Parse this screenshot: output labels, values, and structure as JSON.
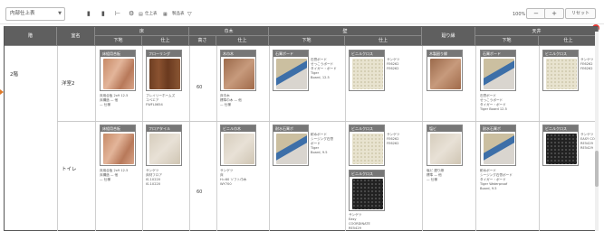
{
  "toolbar": {
    "select_value": "内部仕上表",
    "show_top_label": "仕上表",
    "show_bottom_label": "製品表",
    "zoom": "100%",
    "zoom_out": "−",
    "zoom_in": "+",
    "reset": "リセット"
  },
  "header": {
    "floor": "階",
    "room": "室名",
    "floor_group": "床",
    "baseboard_group": "巾木",
    "wall_group": "壁",
    "edge_group": "廻り縁",
    "ceiling_group": "天井",
    "base": "下地",
    "finish": "仕上",
    "height": "高さ"
  },
  "rows": [
    {
      "floor": "2階",
      "room": "洋室2",
      "height": "60"
    },
    {
      "floor": "",
      "room": "トイレ",
      "height": "60"
    }
  ],
  "cards": {
    "r1_floor_base": {
      "caption": "床組用合板",
      "text": "床用合板 2x9 12.5\n床構造 — 他\n— 仕様"
    },
    "r1_floor_finish": {
      "caption": "フローリング",
      "text": "ブレイリーホームズ\nコベエア\nFWFL0654"
    },
    "r1_base_finish": {
      "caption": "木巾木",
      "text": "床巾木\n標準巾木 — 他\n— 仕様"
    },
    "r1_wall_base": {
      "caption": "石膏ボード",
      "text": "石膏ボード\nせっこうボード\nタイガー・ボード\nTiger\nBoard, 12.5"
    },
    "r1_wall_finish": {
      "caption": "ビニルクロス",
      "text": "サンゲツ\nFE6262\nFE6262"
    },
    "r1_edge_finish": {
      "caption": "木製廻り縁",
      "text": ""
    },
    "r1_ceil_base": {
      "caption": "石膏ボード",
      "text": "石膏ボード\nせっこうボード\nタイガー・ボード\nTiger Board 12.5"
    },
    "r1_ceil_finish": {
      "caption": "ビニルクロス",
      "text": "サンゲツ\nFE6262\nFE6262"
    },
    "r2_floor_base": {
      "caption": "床組用合板",
      "text": "床用合板 2x9 12.5\n床構造 — 他\n— 仕様"
    },
    "r2_floor_finish": {
      "caption": "フロアタイル",
      "text": "サンゲツ\n床材フロア\nIS-10220\nIS-10220"
    },
    "r2_base_finish": {
      "caption": "ビニル巾木",
      "text": "サンゲツ\n床\nH=60 ソフト巾木\nWY700"
    },
    "r2_wall_base": {
      "caption": "耐水石膏ボ",
      "text": "耐水ボード\nシージング石膏\nボード\nTiger\nBoard, 9.5"
    },
    "r2_wall_finish": {
      "caption": "ビニルクロス",
      "text": "サンゲツ\nFE6262\nFE6262"
    },
    "r2_wall_finish2": {
      "caption": "ビニルクロス",
      "text": "サンゲツ\nEasy\nCOORDINATE\nRE5429\nRE5429"
    },
    "r2_edge_finish": {
      "caption": "塩ビ",
      "text": "塩ビ 廻り縁\n標準 — 他\n— 仕様"
    },
    "r2_ceil_base": {
      "caption": "耐水石膏ボ",
      "text": "耐水ボード\nシージング石膏ボード\nタイガー・ボード\nTiger Waterproof\nBoard, 9.5"
    },
    "r2_ceil_finish": {
      "caption": "ビニルクロス",
      "text": "サンゲツ\nEASY CO\nRE5429\nRE5429"
    }
  }
}
